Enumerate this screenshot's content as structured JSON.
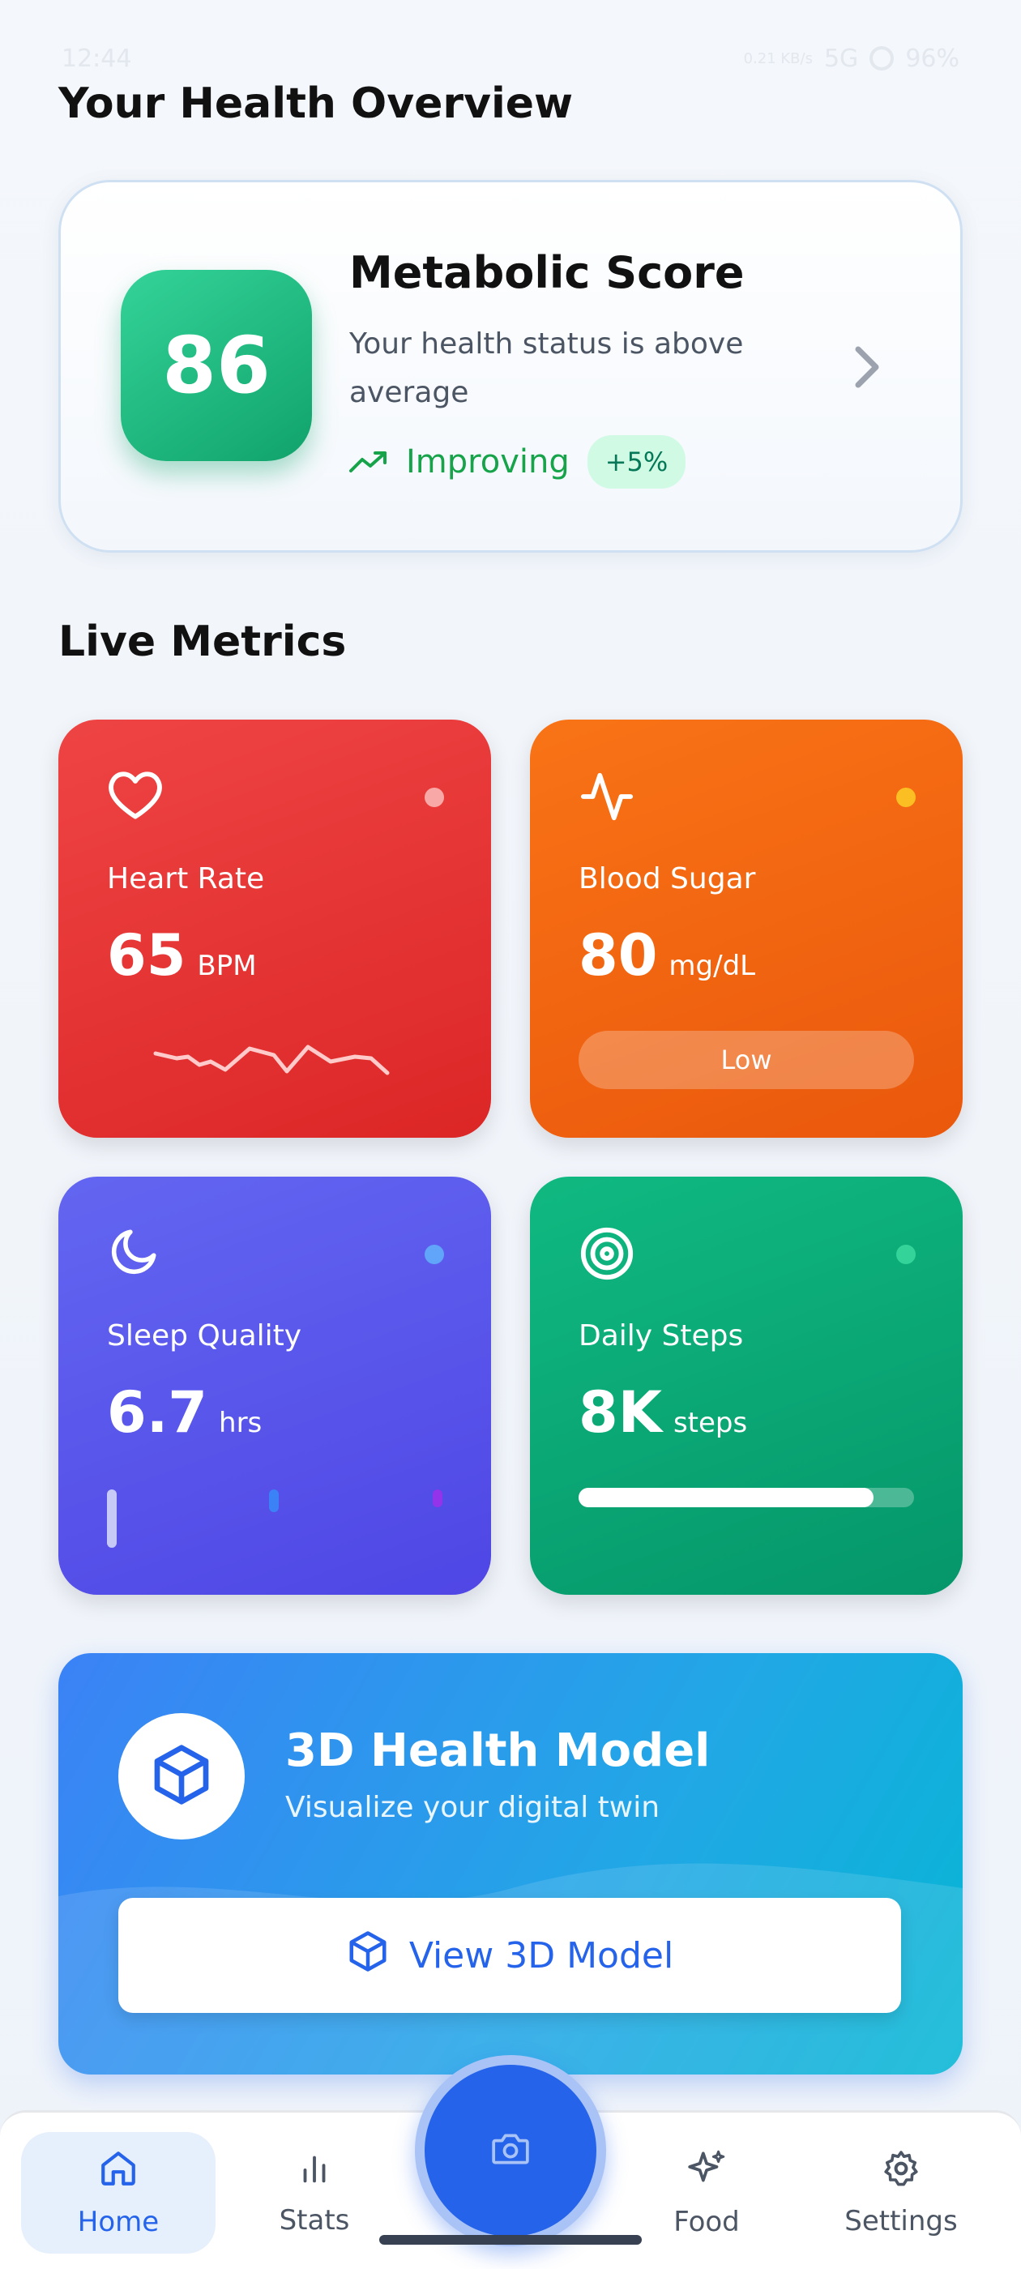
{
  "status_bar": {
    "time": "12:44",
    "network_speed": "0.21 KB/s",
    "network_type": "5G",
    "battery": "96%"
  },
  "overview": {
    "title": "Your Health Overview"
  },
  "metabolic": {
    "score": "86",
    "title": "Metabolic Score",
    "description": "Your health status is above average",
    "trend_label": "Improving",
    "trend_change": "+5%"
  },
  "live_metrics": {
    "title": "Live Metrics",
    "cards": [
      {
        "label": "Heart Rate",
        "value": "65",
        "unit": "BPM",
        "icon": "heart-icon",
        "dot_color": "#f9a8a8"
      },
      {
        "label": "Blood Sugar",
        "value": "80",
        "unit": "mg/dL",
        "icon": "activity-icon",
        "dot_color": "#fbbf24",
        "status": "Low"
      },
      {
        "label": "Sleep Quality",
        "value": "6.7",
        "unit": "hrs",
        "icon": "moon-icon",
        "dot_color": "#60a5fa"
      },
      {
        "label": "Daily Steps",
        "value": "8K",
        "unit": "steps",
        "icon": "target-icon",
        "dot_color": "#34d399",
        "progress": 0.88
      }
    ]
  },
  "model_card": {
    "title": "3D Health Model",
    "subtitle": "Visualize your digital twin",
    "button_label": "View 3D Model",
    "icon": "cube-icon"
  },
  "nav": {
    "items": [
      {
        "label": "Home",
        "icon": "home-icon",
        "active": true
      },
      {
        "label": "Stats",
        "icon": "bar-chart-icon"
      },
      {
        "label": "Food",
        "icon": "sparkles-icon"
      },
      {
        "label": "Settings",
        "icon": "gear-icon"
      }
    ],
    "center_icon": "camera-icon"
  },
  "colors": {
    "primary": "#2563eb",
    "success": "#10b981",
    "heart": "#ef4444",
    "sugar": "#f97316",
    "sleep": "#6366f1",
    "steps": "#059669"
  }
}
